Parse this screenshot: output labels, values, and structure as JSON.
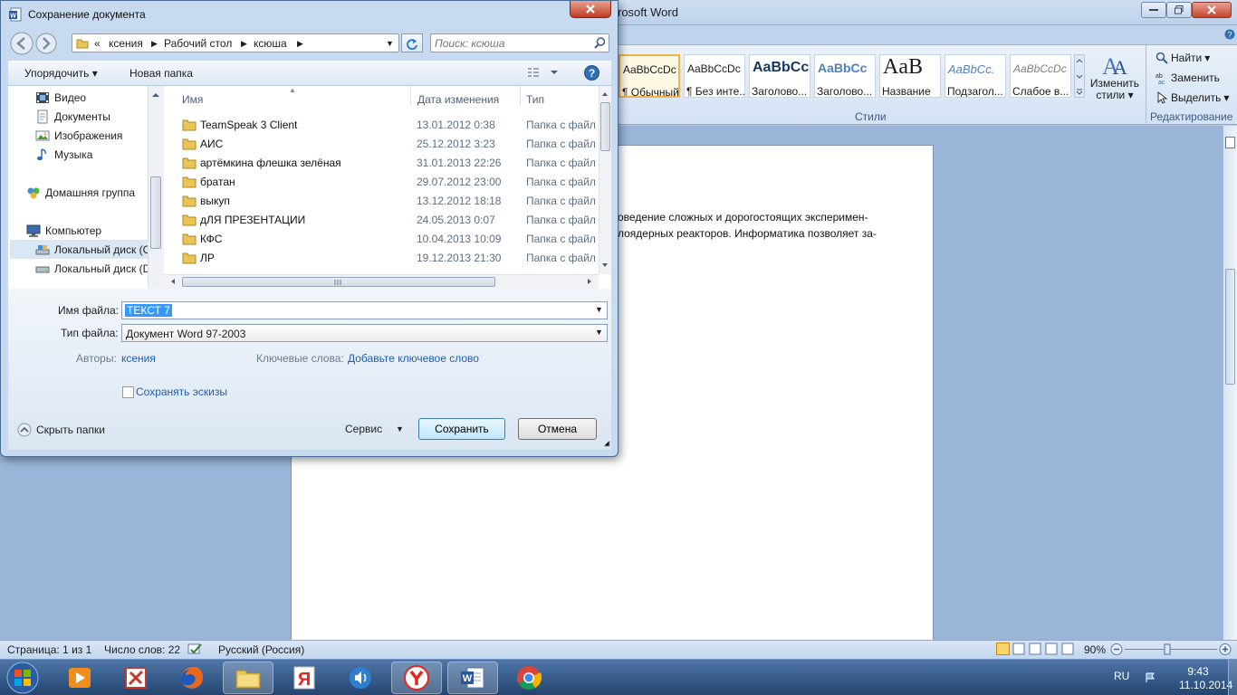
{
  "word": {
    "title": "rosoft Word",
    "styles": [
      {
        "sample": "AaBbCcDc",
        "name": "¶ Обычный"
      },
      {
        "sample": "AaBbCcDc",
        "name": "¶ Без инте..."
      },
      {
        "sample": "AaBbCc",
        "name": "Заголово..."
      },
      {
        "sample": "AaBbCc",
        "name": "Заголово..."
      },
      {
        "sample": "AaB",
        "name": "Название"
      },
      {
        "sample": "AaBbCc.",
        "name": "Подзагол..."
      },
      {
        "sample": "AaBbCcDc",
        "name": "Слабое в..."
      }
    ],
    "change_styles_label": [
      "Изменить",
      "стили ▾"
    ],
    "styles_group_label": "Стили",
    "editing": {
      "find": "Найти",
      "replace": "Заменить",
      "select": "Выделить",
      "group_label": "Редактирование"
    },
    "doc_lines": [
      "оведение сложных и дорогостоящих эксперимен-",
      "лоядерных реакторов. Информатика позволяет за-"
    ],
    "status": {
      "page": "Страница: 1 из 1",
      "words": "Число слов: 22",
      "language": "Русский (Россия)",
      "zoom": "90%"
    }
  },
  "taskbar": {
    "lang": "RU",
    "time": "9:43",
    "date": "11.10.2014"
  },
  "dialog": {
    "title": "Сохранение документа",
    "breadcrumb": [
      "«",
      "ксения",
      "Рабочий стол",
      "ксюша"
    ],
    "search_placeholder": "Поиск: ксюша",
    "toolbar": {
      "organize": "Упорядочить ▾",
      "new_folder": "Новая папка"
    },
    "nav_items": [
      {
        "label": "Видео",
        "icon": "video-icon"
      },
      {
        "label": "Документы",
        "icon": "documents-icon"
      },
      {
        "label": "Изображения",
        "icon": "images-icon"
      },
      {
        "label": "Музыка",
        "icon": "music-icon"
      },
      {
        "label": "Домашняя группа",
        "icon": "homegroup-icon"
      },
      {
        "label": "Компьютер",
        "icon": "computer-icon"
      },
      {
        "label": "Локальный диск (C",
        "icon": "drive-icon"
      },
      {
        "label": "Локальный диск (D",
        "icon": "drive-icon"
      }
    ],
    "columns": {
      "name": "Имя",
      "date": "Дата изменения",
      "type": "Тип"
    },
    "files": [
      {
        "name": "TeamSpeak 3 Client",
        "date": "13.01.2012 0:38",
        "type": "Папка с файл"
      },
      {
        "name": "АИС",
        "date": "25.12.2012 3:23",
        "type": "Папка с файл"
      },
      {
        "name": "артёмкина флешка зелёная",
        "date": "31.01.2013 22:26",
        "type": "Папка с файл"
      },
      {
        "name": "братан",
        "date": "29.07.2012 23:00",
        "type": "Папка с файл"
      },
      {
        "name": "выкуп",
        "date": "13.12.2012 18:18",
        "type": "Папка с файл"
      },
      {
        "name": "дЛЯ ПРЕЗЕНТАЦИИ",
        "date": "24.05.2013 0:07",
        "type": "Папка с файл"
      },
      {
        "name": "КФС",
        "date": "10.04.2013 10:09",
        "type": "Папка с файл"
      },
      {
        "name": "ЛР",
        "date": "19.12.2013 21:30",
        "type": "Папка с файл"
      }
    ],
    "filename_label": "Имя файла:",
    "filename_value": "ТЕКСТ 7",
    "filetype_label": "Тип файла:",
    "filetype_value": "Документ Word 97-2003",
    "authors_label": "Авторы:",
    "authors_value": "ксения",
    "keywords_label": "Ключевые слова:",
    "keywords_value": "Добавьте ключевое слово",
    "thumbnails_label": "Сохранять эскизы",
    "hide_folders": "Скрыть папки",
    "tools": "Сервис",
    "save": "Сохранить",
    "cancel": "Отмена"
  }
}
